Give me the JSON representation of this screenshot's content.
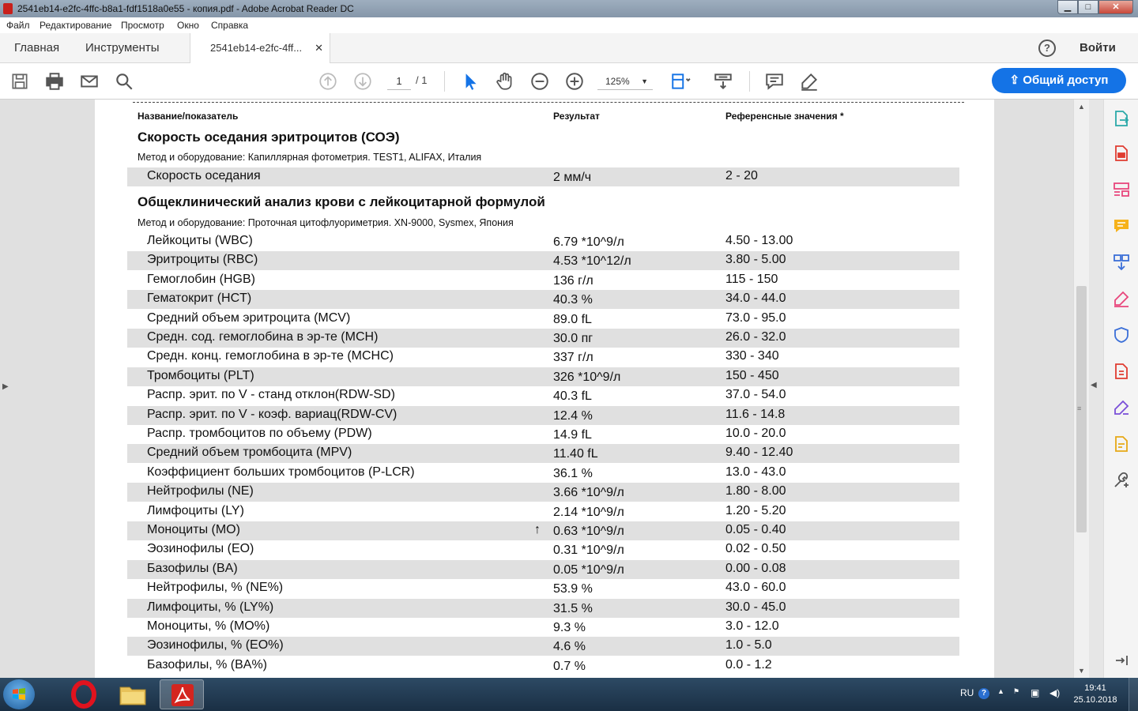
{
  "window": {
    "title": "2541eb14-e2fc-4ffc-b8a1-fdf1518a0e55 - копия.pdf - Adobe Acrobat Reader DC",
    "min": "▁",
    "max": "□",
    "close": "✕"
  },
  "menu": [
    "Файл",
    "Редактирование",
    "Просмотр",
    "Окно",
    "Справка"
  ],
  "tabs": {
    "home": "Главная",
    "tools": "Инструменты",
    "doc": "2541eb14-e2fc-4ff...",
    "close": "✕"
  },
  "header_right": {
    "help": "?",
    "signin": "Войти"
  },
  "toolbar": {
    "page_current": "1",
    "page_total": "/ 1",
    "zoom": "125%",
    "share": "Общий доступ"
  },
  "document": {
    "col_name": "Название/показатель",
    "col_result": "Результат",
    "col_ref": "Референсные значения *",
    "sections": [
      {
        "title": "Скорость оседания эритроцитов (СОЭ)",
        "method": "Метод и оборудование:  Капиллярная фотометрия. TEST1, ALIFAX, Италия",
        "rows": [
          {
            "name": "Скорость оседания",
            "result": "2 мм/ч",
            "ref": "2 - 20",
            "flag": ""
          }
        ]
      },
      {
        "title": "Общеклинический анализ крови с лейкоцитарной формулой",
        "method": "Метод и оборудование:  Проточная цитофлуориметрия. XN-9000, Sysmex, Япония",
        "rows": [
          {
            "name": "Лейкоциты (WBC)",
            "result": "6.79 *10^9/л",
            "ref": "4.50 - 13.00",
            "flag": ""
          },
          {
            "name": "Эритроциты (RBC)",
            "result": "4.53 *10^12/л",
            "ref": "3.80 - 5.00",
            "flag": ""
          },
          {
            "name": "Гемоглобин (HGB)",
            "result": "136 г/л",
            "ref": "115 - 150",
            "flag": ""
          },
          {
            "name": "Гематокрит (HCT)",
            "result": "40.3 %",
            "ref": "34.0 - 44.0",
            "flag": ""
          },
          {
            "name": "Средний объем эритроцита (MCV)",
            "result": "89.0 fL",
            "ref": "73.0 - 95.0",
            "flag": ""
          },
          {
            "name": "Средн. сод. гемоглобина в эр-те (MCH)",
            "result": "30.0 пг",
            "ref": "26.0 - 32.0",
            "flag": ""
          },
          {
            "name": "Средн. конц. гемоглобина в эр-те (MCHC)",
            "result": "337 г/л",
            "ref": "330 - 340",
            "flag": ""
          },
          {
            "name": "Тромбоциты (PLT)",
            "result": "326 *10^9/л",
            "ref": "150 - 450",
            "flag": ""
          },
          {
            "name": "Распр. эрит. по V - станд отклон(RDW-SD)",
            "result": "40.3 fL",
            "ref": "37.0 - 54.0",
            "flag": ""
          },
          {
            "name": "Распр. эрит. по V - коэф. вариац(RDW-CV)",
            "result": "12.4 %",
            "ref": "11.6 - 14.8",
            "flag": ""
          },
          {
            "name": "Распр. тромбоцитов по объему (PDW)",
            "result": "14.9 fL",
            "ref": "10.0 - 20.0",
            "flag": ""
          },
          {
            "name": "Средний объем тромбоцита (MPV)",
            "result": "11.40 fL",
            "ref": "9.40 - 12.40",
            "flag": ""
          },
          {
            "name": "Коэффициент больших тромбоцитов (P-LCR)",
            "result": "36.1 %",
            "ref": "13.0 - 43.0",
            "flag": ""
          },
          {
            "name": "Нейтрофилы (NE)",
            "result": "3.66 *10^9/л",
            "ref": "1.80 - 8.00",
            "flag": ""
          },
          {
            "name": "Лимфоциты (LY)",
            "result": "2.14 *10^9/л",
            "ref": "1.20 - 5.20",
            "flag": ""
          },
          {
            "name": "Моноциты (MO)",
            "result": "0.63 *10^9/л",
            "ref": "0.05 - 0.40",
            "flag": "↑"
          },
          {
            "name": "Эозинофилы (EO)",
            "result": "0.31 *10^9/л",
            "ref": "0.02 - 0.50",
            "flag": ""
          },
          {
            "name": "Базофилы (BA)",
            "result": "0.05 *10^9/л",
            "ref": "0.00 - 0.08",
            "flag": ""
          },
          {
            "name": "Нейтрофилы, % (NE%)",
            "result": "53.9 %",
            "ref": "43.0 - 60.0",
            "flag": ""
          },
          {
            "name": "Лимфоциты, % (LY%)",
            "result": "31.5 %",
            "ref": "30.0 - 45.0",
            "flag": ""
          },
          {
            "name": "Моноциты, % (MO%)",
            "result": "9.3 %",
            "ref": "3.0 - 12.0",
            "flag": ""
          },
          {
            "name": "Эозинофилы, % (EO%)",
            "result": "4.6 %",
            "ref": "1.0 - 5.0",
            "flag": ""
          },
          {
            "name": "Базофилы, % (BA%)",
            "result": "0.7 %",
            "ref": "0.0 - 1.2",
            "flag": ""
          }
        ]
      }
    ]
  },
  "taskbar": {
    "lang": "RU",
    "time": "19:41",
    "date": "25.10.2018"
  },
  "colors": {
    "accent": "#1473e6",
    "row_shade": "#e0e0e0",
    "acrobat_red": "#d4251f"
  }
}
